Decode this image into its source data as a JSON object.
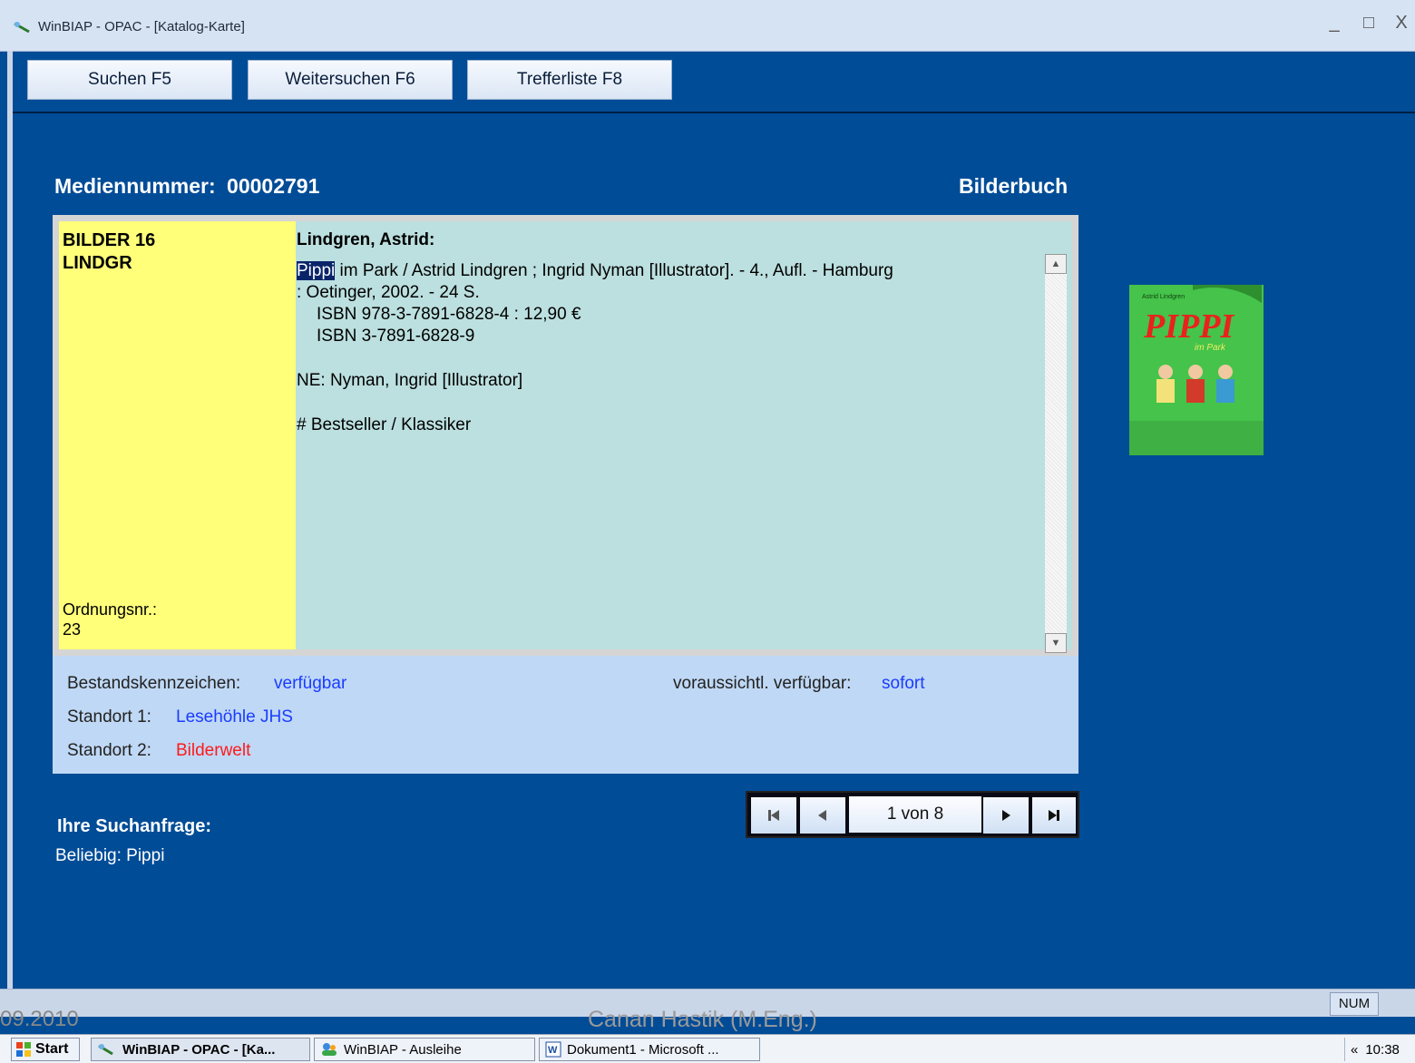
{
  "window": {
    "title": "WinBIAP - OPAC - [Katalog-Karte]",
    "controls": [
      "_",
      "□",
      "X"
    ]
  },
  "toolbar": {
    "search_label": "Suchen F5",
    "continue_label": "Weitersuchen F6",
    "hitlist_label": "Trefferliste F8"
  },
  "record": {
    "media_number_label": "Mediennummer:",
    "media_number": "00002791",
    "media_type": "Bilderbuch",
    "signature_line1": "BILDER 16",
    "signature_line2": "LINDGR",
    "order_label": "Ordnungsnr.:",
    "order_value": "23",
    "author": "Lindgren, Astrid:",
    "title_highlight": "Pippi",
    "title_rest": " im Park / Astrid Lindgren ; Ingrid  Nyman [Illustrator]. - 4., Aufl. - Hamburg",
    "publisher_line": ": Oetinger, 2002. - 24 S.",
    "isbn1": "ISBN 978-3-7891-6828-4 : 12,90 €",
    "isbn2": "ISBN 3-7891-6828-9",
    "ne_line": "NE: Nyman, Ingrid [Illustrator]",
    "tag_line": "# Bestseller / Klassiker"
  },
  "availability": {
    "status_label": "Bestandskennzeichen:",
    "status_value": "verfügbar",
    "expected_label": "voraussichtl. verfügbar:",
    "expected_value": "sofort",
    "location1_label": "Standort 1:",
    "location1_value": "Lesehöhle JHS",
    "location2_label": "Standort 2:",
    "location2_value": "Bilderwelt"
  },
  "navigation": {
    "first_icon": "first-icon",
    "prev_icon": "previous-icon",
    "next_icon": "next-icon",
    "last_icon": "last-icon",
    "counter": "1 von 8"
  },
  "query": {
    "title": "Ihre Suchanfrage:",
    "value": "Beliebig: Pippi"
  },
  "cover": {
    "author_line": "Astrid Lindgren",
    "title": "PIPPI",
    "subtitle": "im Park"
  },
  "statusbar": {
    "num": "NUM"
  },
  "footer": {
    "date": "09.2010",
    "author": "Canan Hastik (M.Eng.)"
  },
  "taskbar": {
    "start": "Start",
    "task1": "WinBIAP - OPAC - [Ka...",
    "task2": "WinBIAP - Ausleihe",
    "task3": "Dokument1 - Microsoft ...",
    "clock": "10:38",
    "tray_toggle": "«"
  },
  "colors": {
    "background": "#004c97",
    "signature_bg": "#ffff7a",
    "card_bg": "#bcdfdf",
    "info_bg": "#bfd8f5",
    "link_blue": "#1a3cff",
    "alert_red": "#ff1a1a"
  }
}
